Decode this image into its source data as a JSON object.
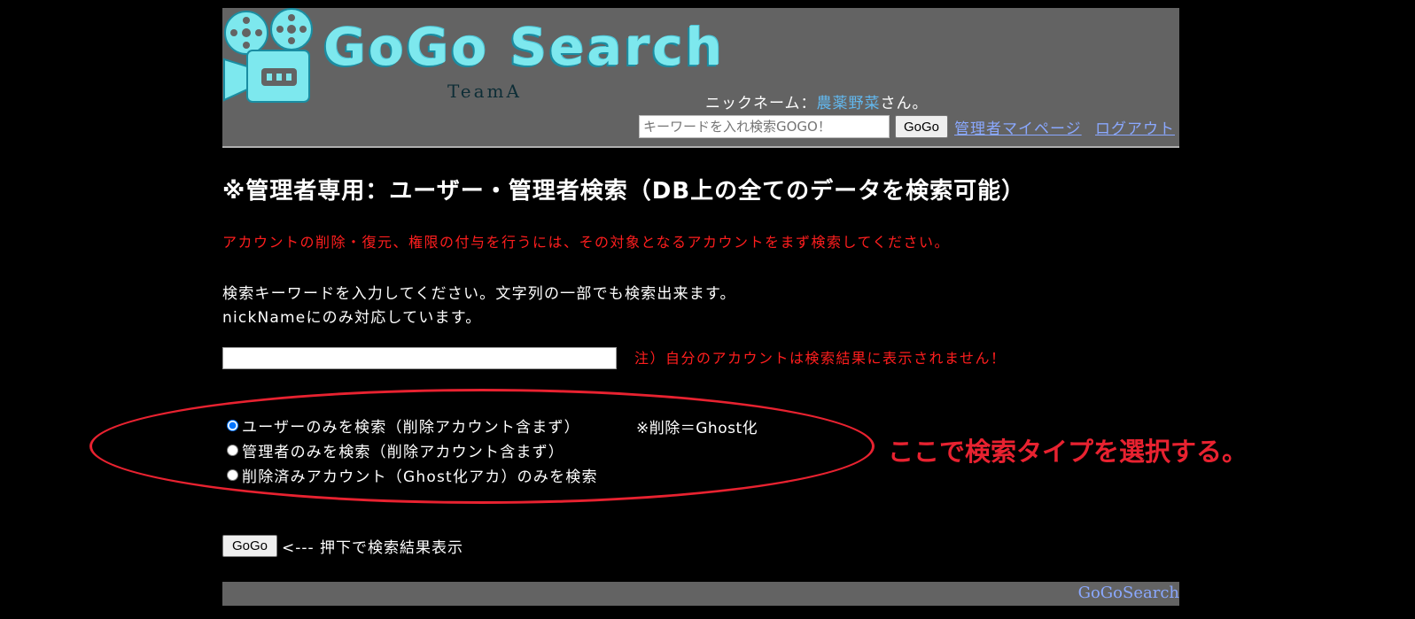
{
  "header": {
    "logo_text": "GoGo Search",
    "team_text": "TeamA",
    "nickname_prefix": "ニックネーム：",
    "nickname": "農薬野菜",
    "nickname_suffix": "さん。",
    "search_placeholder": "キーワードを入れ検索GOGO！",
    "search_button": "GoGo",
    "link_mypage": "管理者マイページ",
    "link_logout": "ログアウト",
    "colors": {
      "bar": "#636363",
      "logo": "#7de8ee",
      "link": "#8aa8ff",
      "nickname": "#62b8ef"
    }
  },
  "main": {
    "title": "※管理者専用：ユーザー・管理者検索（DB上の全てのデータを検索可能）",
    "warning": "アカウントの削除・復元、権限の付与を行うには、その対象となるアカウントをまず検索してください。",
    "instruction_1": "検索キーワードを入力してください。文字列の一部でも検索出来ます。",
    "instruction_2": "nickNameにのみ対応しています。",
    "keyword_value": "",
    "note": "注）自分のアカウントは検索結果に表示されません！",
    "radio_options": [
      {
        "label": "ユーザーのみを検索（削除アカウント含まず）",
        "checked": true
      },
      {
        "label": "管理者のみを検索（削除アカウント含まず）",
        "checked": false
      },
      {
        "label": "削除済みアカウント（Ghost化アカ）のみを検索",
        "checked": false
      }
    ],
    "ghost_note": "※削除＝Ghost化",
    "annotation": "ここで検索タイプを選択する。",
    "go_button": "GoGo",
    "go_hint": "<--- 押下で検索結果表示",
    "colors": {
      "warning": "#ff1e1e",
      "annotation": "#e82230"
    }
  },
  "footer": {
    "text": "GoGoSearch"
  }
}
